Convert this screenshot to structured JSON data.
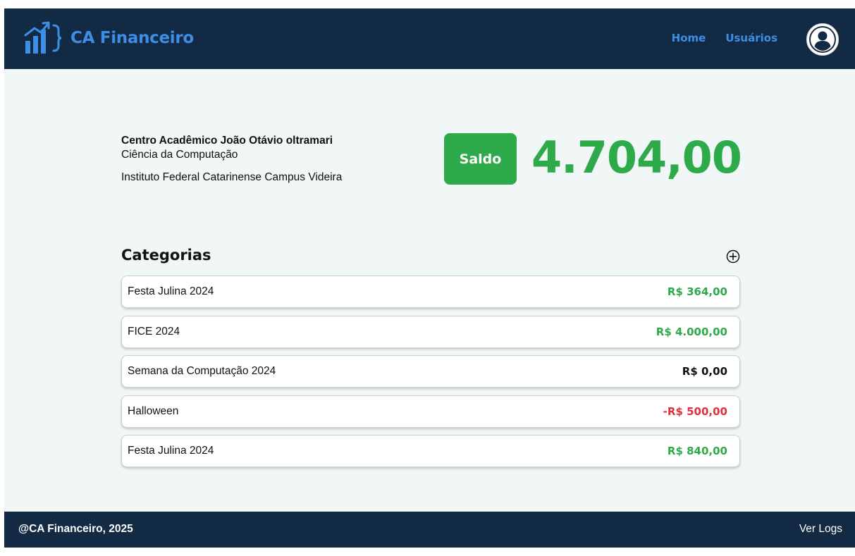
{
  "header": {
    "brand_name": "CA Financeiro",
    "nav": [
      {
        "label": "Home"
      },
      {
        "label": "Usuários"
      }
    ]
  },
  "org": {
    "name": "Centro Acadêmico João Otávio oltramari",
    "course": "Ciência da Computação",
    "institute": "Instituto Federal Catarinense Campus Videira"
  },
  "balance": {
    "label": "Saldo",
    "value": "4.704,00"
  },
  "categories": {
    "title": "Categorias",
    "items": [
      {
        "name": "Festa Julina 2024",
        "amount": "R$ 364,00",
        "status": "positive"
      },
      {
        "name": "FICE 2024",
        "amount": "R$ 4.000,00",
        "status": "positive"
      },
      {
        "name": "Semana da Computação 2024",
        "amount": "R$ 0,00",
        "status": "zero"
      },
      {
        "name": "Halloween",
        "amount": "-R$ 500,00",
        "status": "negative"
      },
      {
        "name": "Festa Julina 2024",
        "amount": "R$ 840,00",
        "status": "positive"
      }
    ]
  },
  "footer": {
    "copyright": "@CA Financeiro, 2025",
    "logs_label": "Ver Logs"
  },
  "colors": {
    "navy": "#132a44",
    "brand_blue": "#3d8fe6",
    "positive_green": "#2eaa4a",
    "negative_red": "#e0303f",
    "background": "#f1f6f6"
  },
  "icons": {
    "logo": "bar-chart-arrow-brace-logo-icon",
    "avatar": "user-avatar-icon",
    "add": "plus-circle-icon"
  }
}
